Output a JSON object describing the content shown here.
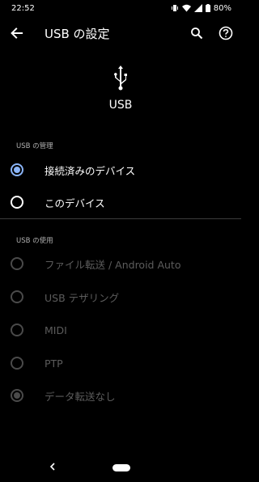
{
  "status_bar": {
    "time": "22:52",
    "battery": "80%",
    "icons": [
      "vibrate-icon",
      "wifi-icon",
      "signal-icon",
      "battery-icon"
    ]
  },
  "app_bar": {
    "title": "USB の設定",
    "icons": [
      "back-arrow-icon",
      "search-icon",
      "help-icon"
    ]
  },
  "header": {
    "icon": "usb-icon",
    "label": "USB"
  },
  "usb_management": {
    "section_label": "USB の管理",
    "options": [
      {
        "label": "接続済みのデバイス",
        "checked": true,
        "enabled": true
      },
      {
        "label": "このデバイス",
        "checked": false,
        "enabled": true
      }
    ]
  },
  "usb_usage": {
    "section_label": "USB の使用",
    "options": [
      {
        "label": "ファイル転送 / Android Auto",
        "checked": false,
        "enabled": false
      },
      {
        "label": "USB テザリング",
        "checked": false,
        "enabled": false
      },
      {
        "label": "MIDI",
        "checked": false,
        "enabled": false
      },
      {
        "label": "PTP",
        "checked": false,
        "enabled": false
      },
      {
        "label": "データ転送なし",
        "checked": true,
        "enabled": false
      }
    ]
  },
  "colors": {
    "background": "#000000",
    "accent": "#8ab4f8",
    "disabled": "#5c5c5c",
    "divider": "#3c3c3c"
  }
}
